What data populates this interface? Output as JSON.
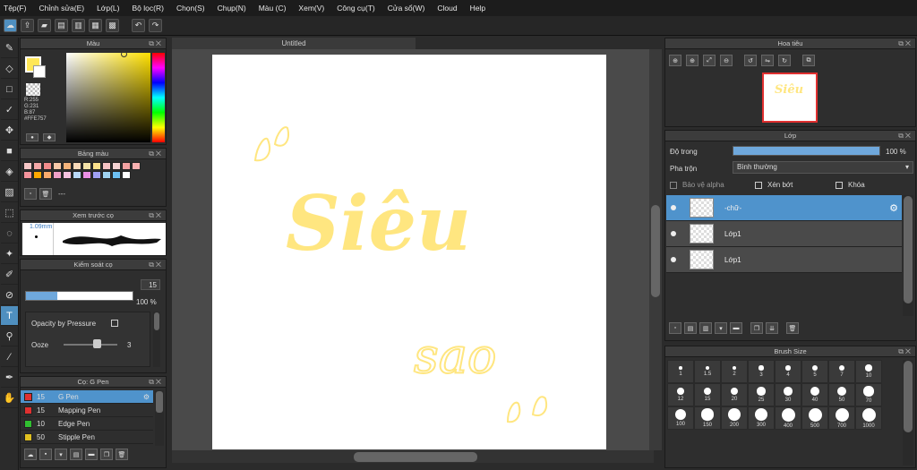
{
  "menu": [
    "Tệp(F)",
    "Chỉnh sửa(E)",
    "Lớp(L)",
    "Bộ lọc(R)",
    "Chọn(S)",
    "Chụp(N)",
    "Màu (C)",
    "Xem(V)",
    "Công cụ(T)",
    "Cửa sổ(W)",
    "Cloud",
    "Help"
  ],
  "document_tab": "Untitled",
  "color_panel": {
    "title": "Màu",
    "r": "R:255",
    "g": "G:231",
    "b": "B:87",
    "hex": "#FFE757",
    "main_color": "#FFE757"
  },
  "palette_panel": {
    "title": "Bảng màu",
    "swatches": [
      "#f7c7c7",
      "#f4a7a7",
      "#f28b8b",
      "#f9c9a9",
      "#f5b37b",
      "#f9d9b9",
      "#f4e2a8",
      "#fbe08b",
      "#f7c3c3",
      "#f6d3d3",
      "#f4a2a2",
      "#f9b0b0",
      "#f4939c",
      "#ffa800",
      "#f9aa6c",
      "#efa0c7",
      "#f6c2e0",
      "#b9d8f9",
      "#ea8fe5",
      "#a0a0f4",
      "#9fd2f0",
      "#6dbff2",
      "#ffffff"
    ],
    "empty_label": "---"
  },
  "preview_panel": {
    "title": "Xem trước cọ",
    "size": "1.09mm"
  },
  "brush_control": {
    "title": "Kiểm soát cọ",
    "size_value": "15",
    "opacity_value": "100 %",
    "opacity_pressure_label": "Opacity by Pressure",
    "ooze_label": "Ooze",
    "ooze_value": "3"
  },
  "brush_list": {
    "title": "Cọ: G Pen",
    "items": [
      {
        "size": "15",
        "name": "G Pen",
        "color": "#e03030"
      },
      {
        "size": "15",
        "name": "Mapping Pen",
        "color": "#e03030"
      },
      {
        "size": "10",
        "name": "Edge Pen",
        "color": "#30c030"
      },
      {
        "size": "50",
        "name": "Stipple Pen",
        "color": "#e0c020"
      }
    ]
  },
  "navigator": {
    "title": "Hoa tiêu"
  },
  "layer_panel": {
    "title": "Lớp",
    "opacity_label": "Độ trong",
    "opacity_value": "100 %",
    "blend_label": "Pha trộn",
    "blend_value": "Bình thường",
    "protect_alpha": "Bảo vệ alpha",
    "clipping": "Xén bớt",
    "lock": "Khóa",
    "layers": [
      {
        "name": "-chữ-"
      },
      {
        "name": "Lớp1"
      },
      {
        "name": "Lớp1"
      }
    ]
  },
  "brush_size": {
    "title": "Brush Size",
    "sizes": [
      "1",
      "1.5",
      "2",
      "3",
      "4",
      "5",
      "7",
      "10",
      "12",
      "15",
      "20",
      "25",
      "30",
      "40",
      "50",
      "70",
      "100",
      "150",
      "200",
      "300",
      "400",
      "500",
      "700",
      "1000"
    ]
  },
  "canvas_text": {
    "line1": "Siêu",
    "line2": "sao"
  }
}
